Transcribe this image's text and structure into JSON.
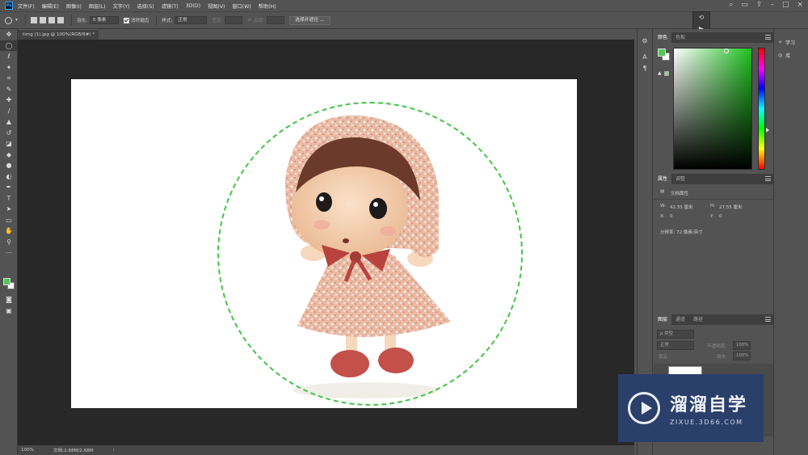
{
  "app": {
    "menus": [
      "文件(F)",
      "编辑(E)",
      "图像(I)",
      "图层(L)",
      "文字(Y)",
      "选择(S)",
      "滤镜(T)",
      "3D(D)",
      "视图(V)",
      "窗口(W)",
      "帮助(H)"
    ]
  },
  "options": {
    "feather_label": "羽化:",
    "feather_value": "0 像素",
    "antialias_label": "消除锯齿",
    "style_label": "样式:",
    "style_value": "正常",
    "width_label": "宽度:",
    "height_label": "高度:",
    "select_mask_button": "选择并遮住 ..."
  },
  "document": {
    "tab_title": "timg (1).jpg @ 100%(RGB/8#) *",
    "zoom": "100%",
    "doc_size": "文档:2.68M/2.68M",
    "status_arrow": "›"
  },
  "colors": {
    "foreground": "#55c85a",
    "background": "#ffffff",
    "selection": "#46c446",
    "accent": "#31a8ff"
  },
  "panels": {
    "color_tabs": [
      "颜色",
      "色板"
    ],
    "properties_tabs": [
      "属性",
      "调整"
    ],
    "properties_title": "文档属性",
    "width_label": "W:",
    "width_value": "42.33 厘米",
    "height_label": "H:",
    "height_value": "27.55 厘米",
    "x_label": "X:",
    "x_value": "0",
    "y_label": "Y:",
    "y_value": "0",
    "resolution": "分辨率: 72 像素/英寸",
    "layers_tabs": [
      "图层",
      "通道",
      "路径"
    ],
    "layer_filter": "ρ 类型",
    "blend_mode": "正常",
    "opacity_label": "不透明度:",
    "lock_label": "锁定:",
    "fill_label": "填充:",
    "opacity_value": "100%",
    "fill_value": "100%"
  },
  "learn": {
    "learn_label": "学习",
    "library_label": "库"
  },
  "watermark": {
    "title": "溜溜自学",
    "url": "ZIXUE.3D66.COM"
  },
  "icons": {
    "tools": [
      "move-icon",
      "marquee-icon",
      "lasso-icon",
      "magic-wand-icon",
      "crop-icon",
      "eyedropper-icon",
      "healing-icon",
      "brush-icon",
      "stamp-icon",
      "history-brush-icon",
      "eraser-icon",
      "bucket-icon",
      "blur-icon",
      "dodge-icon",
      "pen-icon",
      "type-icon",
      "path-select-icon",
      "rectangle-icon",
      "hand-icon",
      "zoom-icon",
      "more-icon"
    ]
  }
}
